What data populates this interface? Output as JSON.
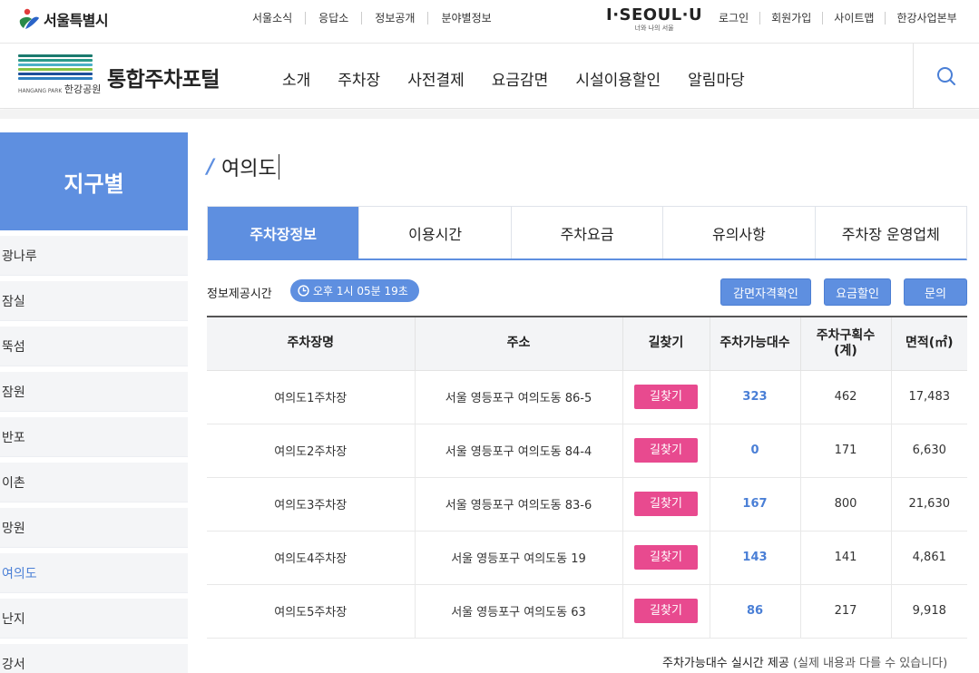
{
  "gov": {
    "logo_text": "서울특별시",
    "links": [
      "서울소식",
      "응답소",
      "정보공개",
      "분야별정보"
    ],
    "brand_main": "I·SEOUL·U",
    "brand_sub": "너와 나의 서울",
    "util_links": [
      "로그인",
      "회원가입",
      "사이트맵",
      "한강사업본부"
    ]
  },
  "header": {
    "logo_caption_en": "HANGANG PARK",
    "logo_caption_ko": "한강공원",
    "title": "통합주차포털",
    "nav": [
      "소개",
      "주차장",
      "사전결제",
      "요금감면",
      "시설이용할인",
      "알림마당"
    ],
    "icons": {
      "search": "search-icon"
    }
  },
  "sidebar": {
    "title": "지구별",
    "items": [
      "광나루",
      "잠실",
      "뚝섬",
      "잠원",
      "반포",
      "이촌",
      "망원",
      "여의도",
      "난지",
      "강서"
    ],
    "active_index": 7
  },
  "content": {
    "heading": "여의도",
    "tabs": [
      "주차장정보",
      "이용시간",
      "주차요금",
      "유의사항",
      "주차장 운영업체"
    ],
    "active_tab": 0,
    "info_label": "정보제공시간",
    "time": "오후 1시 05분 19초",
    "buttons": {
      "check": "감면자격확인",
      "discount": "요금할인",
      "inquiry": "문의"
    },
    "table": {
      "headers": [
        "주차장명",
        "주소",
        "길찾기",
        "주차가능대수",
        "주차구획수\n(계)",
        "면적(㎡)"
      ],
      "route_label": "길찾기",
      "rows": [
        {
          "name": "여의도1주차장",
          "address": "서울 영등포구 여의도동 86-5",
          "available": "323",
          "spaces": "462",
          "area": "17,483"
        },
        {
          "name": "여의도2주차장",
          "address": "서울 영등포구 여의도동 84-4",
          "available": "0",
          "spaces": "171",
          "area": "6,630"
        },
        {
          "name": "여의도3주차장",
          "address": "서울 영등포구 여의도동 83-6",
          "available": "167",
          "spaces": "800",
          "area": "21,630"
        },
        {
          "name": "여의도4주차장",
          "address": "서울 영등포구 여의도동 19",
          "available": "143",
          "spaces": "141",
          "area": "4,861"
        },
        {
          "name": "여의도5주차장",
          "address": "서울 영등포구 여의도동 63",
          "available": "86",
          "spaces": "217",
          "area": "9,918"
        }
      ]
    },
    "footnote_main": "주차가능대수 실시간 제공",
    "footnote_paren": "(실제 내용과 다를 수 있습니다)"
  },
  "colors": {
    "accent": "#5e8fe0",
    "route": "#e84a8f",
    "available": "#4a7fd6"
  }
}
